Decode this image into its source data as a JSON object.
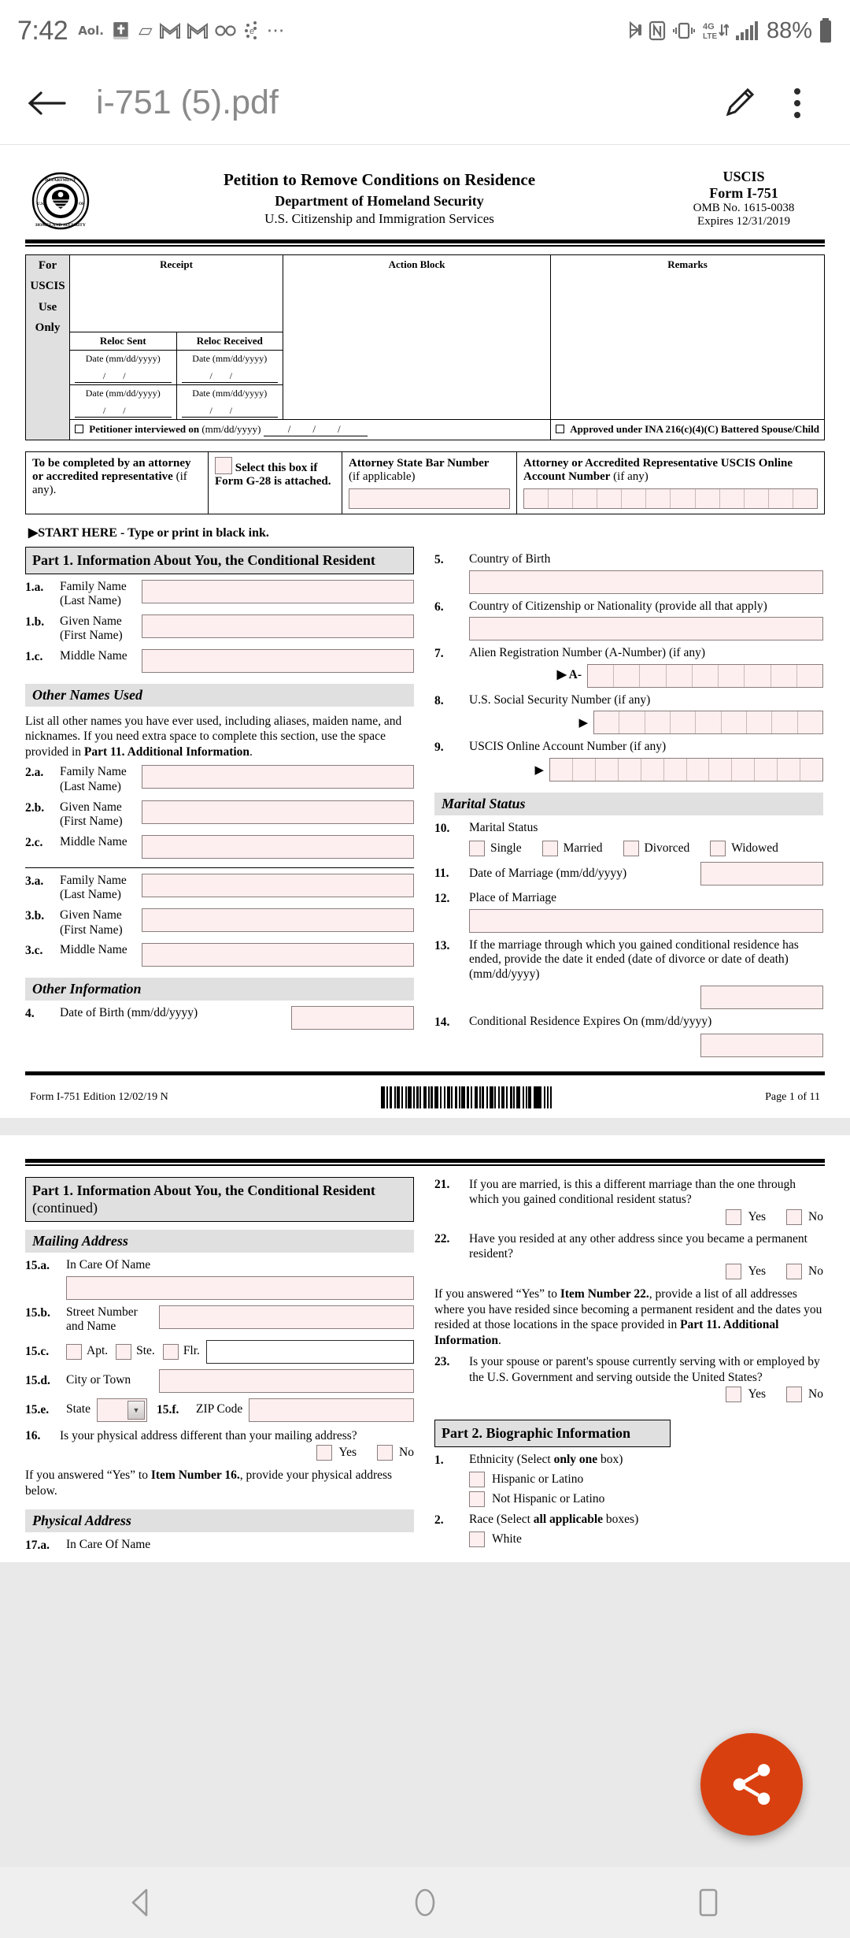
{
  "statusbar": {
    "time": "7:42",
    "left_icons": [
      "aol-icon",
      "bible-app-icon",
      "gmail-icon",
      "gmail-icon",
      "voicemail-icon",
      "evernote-icon",
      "more-icons-icon"
    ],
    "aol_label": "Aol.",
    "right_icons": [
      "bluetooth-icon",
      "nfc-icon",
      "vibrate-icon",
      "lte-4g-icon",
      "signal-bars-icon"
    ],
    "network_label": "4G LTE",
    "battery_percent": "88%"
  },
  "appbar": {
    "back_icon": "back-arrow-icon",
    "title": "i-751 (5).pdf",
    "edit_icon": "pencil-icon",
    "menu_icon": "overflow-menu-icon"
  },
  "fab": {
    "icon": "share-icon",
    "color": "#d9400f"
  },
  "navbar": {
    "back": "nav-back-icon",
    "home": "nav-home-icon",
    "recents": "nav-recents-icon"
  },
  "page1": {
    "header": {
      "seal_icon": "dhs-seal-icon",
      "title": "Petition to Remove Conditions on Residence",
      "dept": "Department of Homeland Security",
      "agency": "U.S. Citizenship and Immigration Services",
      "right": {
        "uscis": "USCIS",
        "form": "Form I-751",
        "omb": "OMB No. 1615-0038",
        "expires": "Expires 12/31/2019"
      }
    },
    "uscis_table": {
      "use_only": "For USCIS Use Only",
      "use_only_lines": [
        "For",
        "USCIS",
        "Use",
        "Only"
      ],
      "receipt": "Receipt",
      "action_block": "Action Block",
      "remarks": "Remarks",
      "reloc_sent": "Reloc Sent",
      "reloc_received": "Reloc Received",
      "date_label": "Date (mm/dd/yyyy)",
      "interview_label": "Petitioner interviewed on",
      "interview_fmt": "(mm/dd/yyyy)",
      "approved_label": "Approved under INA 216(c)(4)(C) Battered Spouse/Child"
    },
    "attorney": {
      "to_be_completed_bold": "To be completed by an attorney or accredited representative",
      "to_be_completed_note": "(if any).",
      "g28_label": "Select this box if Form G-28 is attached.",
      "bar_number_bold": "Attorney State Bar Number",
      "bar_number_note": "(if applicable)",
      "online_acct_bold": "Attorney or Accredited Representative USCIS Online Account Number",
      "online_acct_note": "(if any)"
    },
    "start_here": "▶START HERE - Type or print in black ink.",
    "part1_title_bold": "Part 1.  Information About You, the Conditional Resident",
    "other_names_heading": "Other Names Used",
    "other_names_para_1": "List all other names you have ever used, including aliases, maiden name, and nicknames.  If you need extra space to complete this section, use the space provided in ",
    "other_names_para_bold": "Part 11. Additional Information",
    "other_names_para_2": ".",
    "other_information_heading": "Other Information",
    "marital_status_heading": "Marital Status",
    "names": [
      {
        "num": "1.a.",
        "label": "Family Name\n(Last Name)"
      },
      {
        "num": "1.b.",
        "label": "Given Name\n(First Name)"
      },
      {
        "num": "1.c.",
        "label": "Middle Name"
      },
      {
        "num": "2.a.",
        "label": "Family Name\n(Last Name)"
      },
      {
        "num": "2.b.",
        "label": "Given Name\n(First Name)"
      },
      {
        "num": "2.c.",
        "label": "Middle Name"
      },
      {
        "num": "3.a.",
        "label": "Family Name\n(Last Name)"
      },
      {
        "num": "3.b.",
        "label": "Given Name\n(First Name)"
      },
      {
        "num": "3.c.",
        "label": "Middle Name"
      }
    ],
    "item4": {
      "num": "4.",
      "label": "Date of Birth (mm/dd/yyyy)"
    },
    "item5": {
      "num": "5.",
      "label": "Country of Birth"
    },
    "item6": {
      "num": "6.",
      "label": "Country of Citizenship or Nationality (provide all that apply)"
    },
    "item7": {
      "num": "7.",
      "label": "Alien Registration Number (A-Number) (if any)",
      "prefix": "▶ A-"
    },
    "item8": {
      "num": "8.",
      "label": "U.S. Social Security Number (if any)",
      "prefix": "▶"
    },
    "item9": {
      "num": "9.",
      "label": "USCIS Online Account Number (if any)",
      "prefix": "▶"
    },
    "item10": {
      "num": "10.",
      "label": "Marital Status",
      "options": [
        "Single",
        "Married",
        "Divorced",
        "Widowed"
      ]
    },
    "item11": {
      "num": "11.",
      "label": "Date of Marriage (mm/dd/yyyy)"
    },
    "item12": {
      "num": "12.",
      "label": "Place of Marriage"
    },
    "item13": {
      "num": "13.",
      "label": "If the marriage through which you gained conditional residence has ended, provide the date it ended (date of divorce or date of death) (mm/dd/yyyy)"
    },
    "item14": {
      "num": "14.",
      "label": "Conditional Residence Expires On (mm/dd/yyyy)"
    },
    "footer": {
      "left": "Form I-751   Edition   12/02/19  N",
      "right": "Page 1 of 11",
      "barcode_icon": "barcode-icon"
    }
  },
  "page2": {
    "part1_title_bold": "Part 1.  Information About You, the Conditional Resident",
    "part1_title_note": "(continued)",
    "mailing_heading": "Mailing Address",
    "physical_heading": "Physical Address",
    "item15a": {
      "num": "15.a.",
      "label": "In Care Of Name"
    },
    "item15b": {
      "num": "15.b.",
      "label": "Street Number and Name"
    },
    "item15c": {
      "num": "15.c.",
      "options": [
        "Apt.",
        "Ste.",
        "Flr."
      ]
    },
    "item15d": {
      "num": "15.d.",
      "label": "City or Town"
    },
    "item15e": {
      "num": "15.e.",
      "label": "State",
      "value": ""
    },
    "item15f": {
      "num": "15.f.",
      "label": "ZIP Code"
    },
    "item16": {
      "num": "16.",
      "label": "Is your physical address different than your mailing address?",
      "yes": "Yes",
      "no": "No"
    },
    "item16_note_1": "If you answered “Yes” to ",
    "item16_note_bold": "Item Number 16.",
    "item16_note_2": ", provide your physical address below.",
    "item17a": {
      "num": "17.a.",
      "label": "In Care Of Name"
    },
    "item21": {
      "num": "21.",
      "label": "If you are married, is this a different marriage than the one through which you gained conditional resident status?",
      "yes": "Yes",
      "no": "No"
    },
    "item22": {
      "num": "22.",
      "label": "Have you resided at any other address since you became a permanent resident?",
      "yes": "Yes",
      "no": "No"
    },
    "item22_note_1": "If you answered “Yes” to ",
    "item22_note_bold1": "Item Number 22.",
    "item22_note_2": ", provide a list of all addresses where you have resided since becoming a permanent resident and the dates you resided at those locations in the space provided in ",
    "item22_note_bold2": "Part 11. Additional Information",
    "item22_note_3": ".",
    "item23": {
      "num": "23.",
      "label": "Is your spouse or parent's spouse currently serving with or employed by the U.S. Government and serving outside the United States?",
      "yes": "Yes",
      "no": "No"
    },
    "part2_title": "Part 2.  Biographic Information",
    "p2_item1": {
      "num": "1.",
      "label_1": "Ethnicity (Select ",
      "label_bold": "only one",
      "label_2": " box)",
      "options": [
        "Hispanic or Latino",
        "Not Hispanic or Latino"
      ]
    },
    "p2_item2": {
      "num": "2.",
      "label_1": "Race (Select ",
      "label_bold": "all applicable",
      "label_2": " boxes)",
      "options": [
        "White"
      ]
    }
  }
}
